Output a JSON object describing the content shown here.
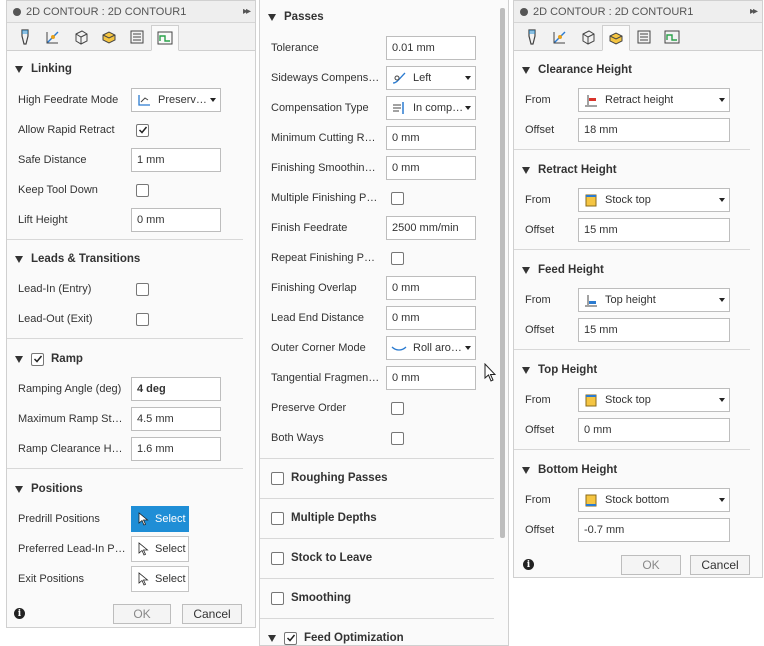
{
  "left_panel": {
    "title": "2D CONTOUR : 2D CONTOUR1",
    "expand": "▸▸",
    "sections": {
      "linking": {
        "title": "Linking",
        "high_feedrate_mode": {
          "label": "High Feedrate Mode",
          "value": "Preserve..."
        },
        "allow_rapid_retract": {
          "label": "Allow Rapid Retract",
          "checked": true
        },
        "safe_distance": {
          "label": "Safe Distance",
          "value": "1 mm"
        },
        "keep_tool_down": {
          "label": "Keep Tool Down",
          "checked": false
        },
        "lift_height": {
          "label": "Lift Height",
          "value": "0 mm"
        }
      },
      "leads": {
        "title": "Leads & Transitions",
        "lead_in": {
          "label": "Lead-In (Entry)",
          "checked": false
        },
        "lead_out": {
          "label": "Lead-Out (Exit)",
          "checked": false
        }
      },
      "ramp": {
        "title": "Ramp",
        "checked": true,
        "ramping_angle": {
          "label": "Ramping Angle (deg)",
          "value": "4 deg"
        },
        "max_ramp_step": {
          "label": "Maximum Ramp Step...",
          "value": "4.5 mm"
        },
        "ramp_clearance": {
          "label": "Ramp Clearance Hei...",
          "value": "1.6 mm"
        }
      },
      "positions": {
        "title": "Positions",
        "predrill": {
          "label": "Predrill Positions",
          "button": "Select"
        },
        "preferred_lead_in": {
          "label": "Preferred Lead-In Po...",
          "button": "Select"
        },
        "exit": {
          "label": "Exit Positions",
          "button": "Select"
        }
      }
    },
    "ok": "OK",
    "cancel": "Cancel"
  },
  "middle_panel": {
    "passes": {
      "title": "Passes",
      "tolerance": {
        "label": "Tolerance",
        "value": "0.01 mm"
      },
      "sideways_comp": {
        "label": "Sideways Compensati...",
        "value": "Left"
      },
      "comp_type": {
        "label": "Compensation Type",
        "value": "In compu..."
      },
      "min_cutting_radius": {
        "label": "Minimum Cutting Rad...",
        "value": "0 mm"
      },
      "finishing_smoothing": {
        "label": "Finishing Smoothing D...",
        "value": "0 mm"
      },
      "multiple_finishing": {
        "label": "Multiple Finishing Pas...",
        "checked": false
      },
      "finish_feedrate": {
        "label": "Finish Feedrate",
        "value": "2500 mm/min"
      },
      "repeat_finishing": {
        "label": "Repeat Finishing Pass",
        "checked": false
      },
      "finishing_overlap": {
        "label": "Finishing Overlap",
        "value": "0 mm"
      },
      "lead_end_distance": {
        "label": "Lead End Distance",
        "value": "0 mm"
      },
      "outer_corner_mode": {
        "label": "Outer Corner Mode",
        "value": "Roll arou..."
      },
      "tangential_fragment": {
        "label": "Tangential Fragment ...",
        "value": "0 mm"
      },
      "preserve_order": {
        "label": "Preserve Order",
        "checked": false
      },
      "both_ways": {
        "label": "Both Ways",
        "checked": false
      }
    },
    "collapsed": [
      {
        "title": "Roughing Passes"
      },
      {
        "title": "Multiple Depths"
      },
      {
        "title": "Stock to Leave"
      },
      {
        "title": "Smoothing"
      }
    ],
    "feed_optimization": {
      "title": "Feed Optimization",
      "checked": true
    }
  },
  "right_panel": {
    "title": "2D CONTOUR : 2D CONTOUR1",
    "expand": "▸▸",
    "from_label": "From",
    "offset_label": "Offset",
    "sections": [
      {
        "title": "Clearance Height",
        "from": "Retract height",
        "offset": "18 mm",
        "icon": "retract-height-icon"
      },
      {
        "title": "Retract Height",
        "from": "Stock top",
        "offset": "15 mm",
        "icon": "stock-top-icon"
      },
      {
        "title": "Feed Height",
        "from": "Top height",
        "offset": "15 mm",
        "icon": "top-height-icon"
      },
      {
        "title": "Top Height",
        "from": "Stock top",
        "offset": "0 mm",
        "icon": "stock-top-icon"
      },
      {
        "title": "Bottom Height",
        "from": "Stock bottom",
        "offset": "-0.7 mm",
        "icon": "stock-bottom-icon"
      }
    ],
    "ok": "OK",
    "cancel": "Cancel"
  },
  "colors": {
    "accent": "#1f8ed6",
    "panel": "#fafafa",
    "border": "#d0d0d0",
    "stock": "#f5c542"
  }
}
